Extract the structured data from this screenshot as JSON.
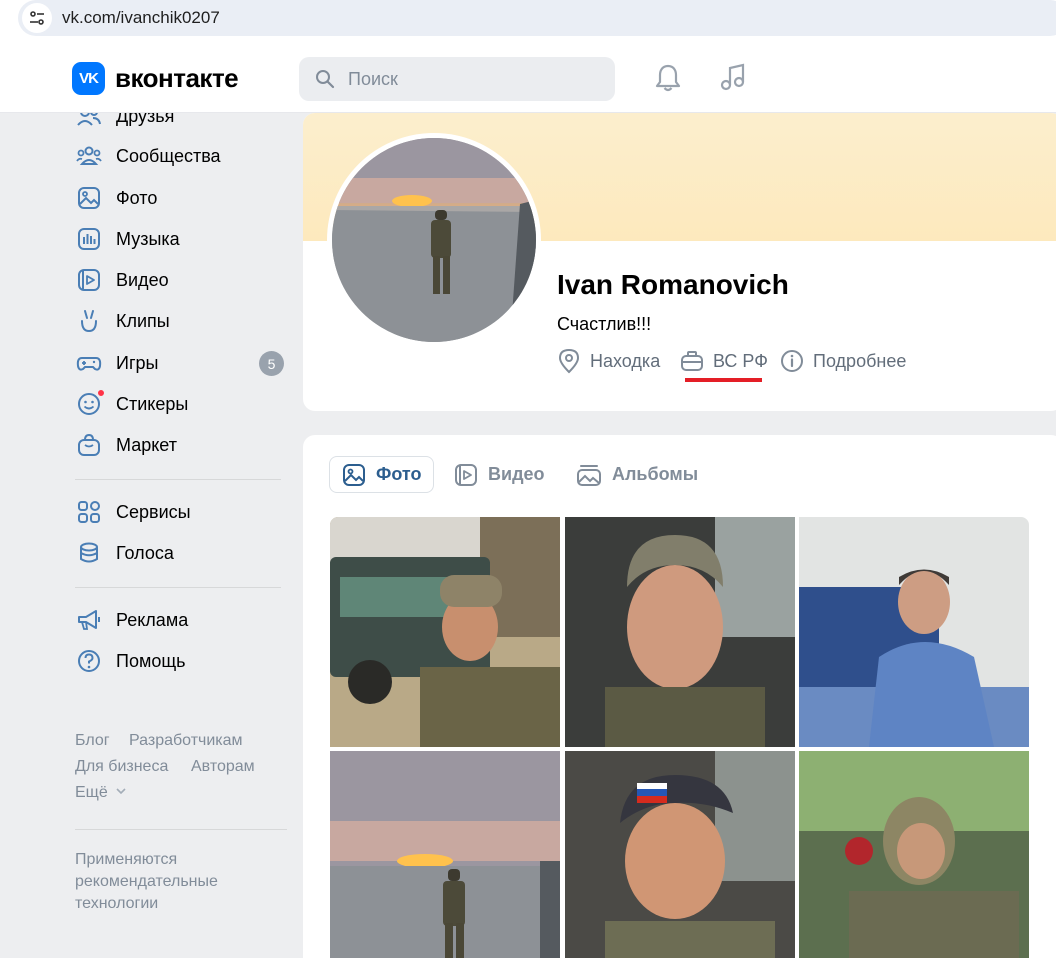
{
  "browser": {
    "url": "vk.com/ivanchik0207"
  },
  "header": {
    "logo_text": "вконтакте",
    "logo_mark": "VK",
    "search_placeholder": "Поиск"
  },
  "sidebar": {
    "items": [
      {
        "label": "Друзья",
        "icon": "friends-icon"
      },
      {
        "label": "Сообщества",
        "icon": "communities-icon"
      },
      {
        "label": "Фото",
        "icon": "photo-icon"
      },
      {
        "label": "Музыка",
        "icon": "music-icon"
      },
      {
        "label": "Видео",
        "icon": "video-icon"
      },
      {
        "label": "Клипы",
        "icon": "clips-icon"
      },
      {
        "label": "Игры",
        "icon": "games-icon",
        "badge": "5"
      },
      {
        "label": "Стикеры",
        "icon": "stickers-icon"
      },
      {
        "label": "Маркет",
        "icon": "market-icon"
      },
      {
        "label": "Сервисы",
        "icon": "services-icon"
      },
      {
        "label": "Голоса",
        "icon": "votes-icon"
      },
      {
        "label": "Реклама",
        "icon": "ads-icon"
      },
      {
        "label": "Помощь",
        "icon": "help-icon"
      }
    ],
    "footer_links": [
      "Блог",
      "Разработчикам",
      "Для бизнеса",
      "Авторам",
      "Ещё"
    ],
    "footer_note": "Применяются рекомендательные технологии"
  },
  "profile": {
    "name": "Ivan Romanovich",
    "status": "Счастлив!!!",
    "location": "Находка",
    "work": "ВС РФ",
    "details": "Подробнее"
  },
  "media": {
    "tabs": [
      "Фото",
      "Видео",
      "Альбомы"
    ],
    "active_tab": "Фото"
  },
  "colors": {
    "accent": "#0077ff",
    "link": "#2c5e8f",
    "highlight": "#e41e26",
    "cover": "#fde9bd"
  }
}
